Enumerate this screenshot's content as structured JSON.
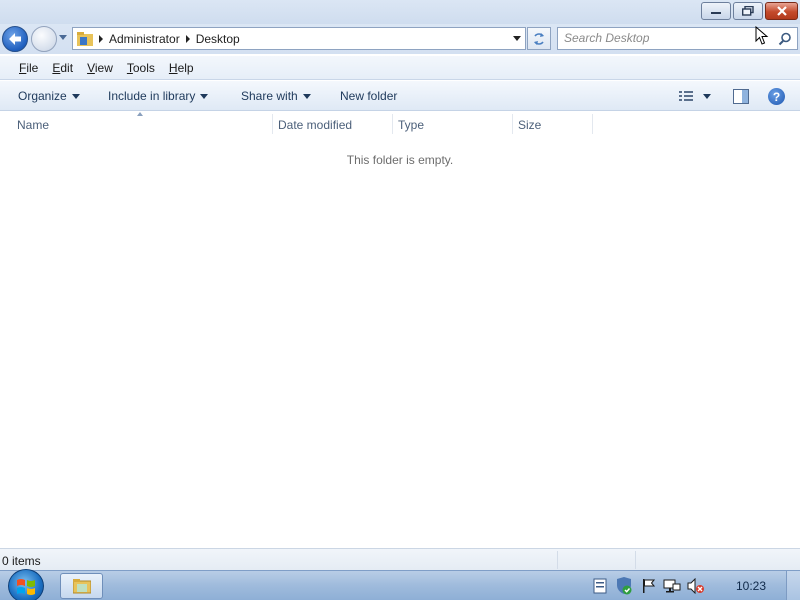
{
  "window": {
    "caption_buttons": [
      "minimize-icon",
      "restore-icon",
      "close-icon"
    ]
  },
  "nav": {
    "breadcrumbs": [
      "Administrator",
      "Desktop"
    ],
    "search_placeholder": "Search Desktop"
  },
  "menu": {
    "items": [
      "File",
      "Edit",
      "View",
      "Tools",
      "Help"
    ],
    "accelerators": [
      "F",
      "E",
      "V",
      "T",
      "H"
    ]
  },
  "commands": {
    "organize": "Organize",
    "include_in_library": "Include in library",
    "share_with": "Share with",
    "new_folder": "New folder",
    "help": "?"
  },
  "columns": [
    "Name",
    "Date modified",
    "Type",
    "Size"
  ],
  "content": {
    "empty_message": "This folder is empty."
  },
  "status": {
    "item_count": "0 items"
  },
  "taskbar": {
    "clock": "10:23",
    "tray_icons": [
      "document-icon",
      "security-shield-icon",
      "action-center-flag-icon",
      "network-icon",
      "volume-muted-icon"
    ]
  },
  "colors": {
    "accent": "#1e395b",
    "titlebar": "#dbe6f4",
    "close_button": "#c44b2c",
    "taskbar": "#9fbbdc"
  }
}
